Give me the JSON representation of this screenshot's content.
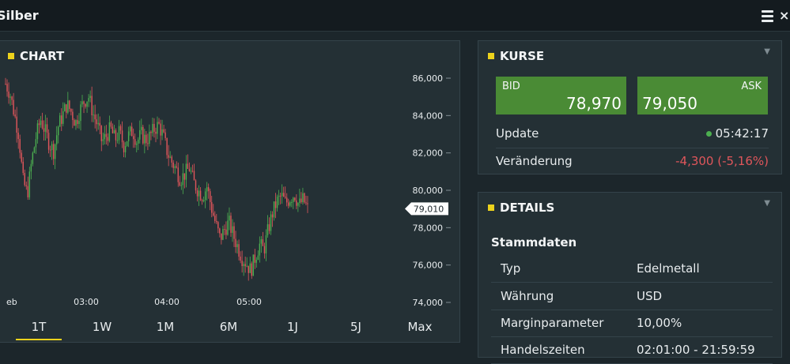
{
  "window": {
    "title": "Silber",
    "menu_icon": "hamburger-icon",
    "close_icon": "close-icon",
    "close_glyph": "×"
  },
  "chart_panel": {
    "title": "CHART",
    "range_tabs": [
      "1T",
      "1W",
      "1M",
      "6M",
      "1J",
      "5J",
      "Max"
    ],
    "active_tab": "1T",
    "current_price_label": "79,010"
  },
  "chart_data": {
    "type": "candlestick",
    "x_tick_labels": [
      "eb",
      "03:00",
      "04:00",
      "05:00"
    ],
    "y_tick_labels": [
      "86,000",
      "84,000",
      "82,000",
      "80,000",
      "78,000",
      "76,000",
      "74,000"
    ],
    "ylim": [
      74,
      86
    ],
    "grid": false,
    "up_color": "#4caf50",
    "down_color": "#e0565b",
    "approx_close_series": [
      85.7,
      85.2,
      84.1,
      83.0,
      80.5,
      79.8,
      81.6,
      82.9,
      83.8,
      83.2,
      82.5,
      82.1,
      83.4,
      84.0,
      84.6,
      84.2,
      83.6,
      84.3,
      84.8,
      85.0,
      84.1,
      83.5,
      82.6,
      82.9,
      83.3,
      82.7,
      83.1,
      82.4,
      82.9,
      83.2,
      82.6,
      83.0,
      82.7,
      82.9,
      83.3,
      83.5,
      82.9,
      82.0,
      81.5,
      81.1,
      80.6,
      80.9,
      81.2,
      80.4,
      80.0,
      79.7,
      80.2,
      79.1,
      78.2,
      77.4,
      77.9,
      78.3,
      77.6,
      77.0,
      76.4,
      76.1,
      75.7,
      76.4,
      77.1,
      76.8,
      77.9,
      78.8,
      79.4,
      79.7,
      79.3,
      79.6,
      79.8,
      79.2,
      79.5,
      79.0
    ]
  },
  "kurse_panel": {
    "title": "KURSE",
    "bid_label": "BID",
    "bid_value": "78,970",
    "ask_label": "ASK",
    "ask_value": "79,050",
    "update_label": "Update",
    "update_time": "05:42:17",
    "change_label": "Veränderung",
    "change_value": "-4,300 (-5,16%)",
    "colors": {
      "bid_ask_bg": "#4a8b35",
      "negative": "#e0565b",
      "live_dot": "#4caf50"
    }
  },
  "details_panel": {
    "title": "DETAILS",
    "section": "Stammdaten",
    "rows": [
      {
        "key": "Typ",
        "value": "Edelmetall"
      },
      {
        "key": "Währung",
        "value": "USD"
      },
      {
        "key": "Marginparameter",
        "value": "10,00%"
      },
      {
        "key": "Handelszeiten",
        "value": "02:01:00 - 21:59:59"
      }
    ]
  },
  "accent_color": "#ecd21c"
}
